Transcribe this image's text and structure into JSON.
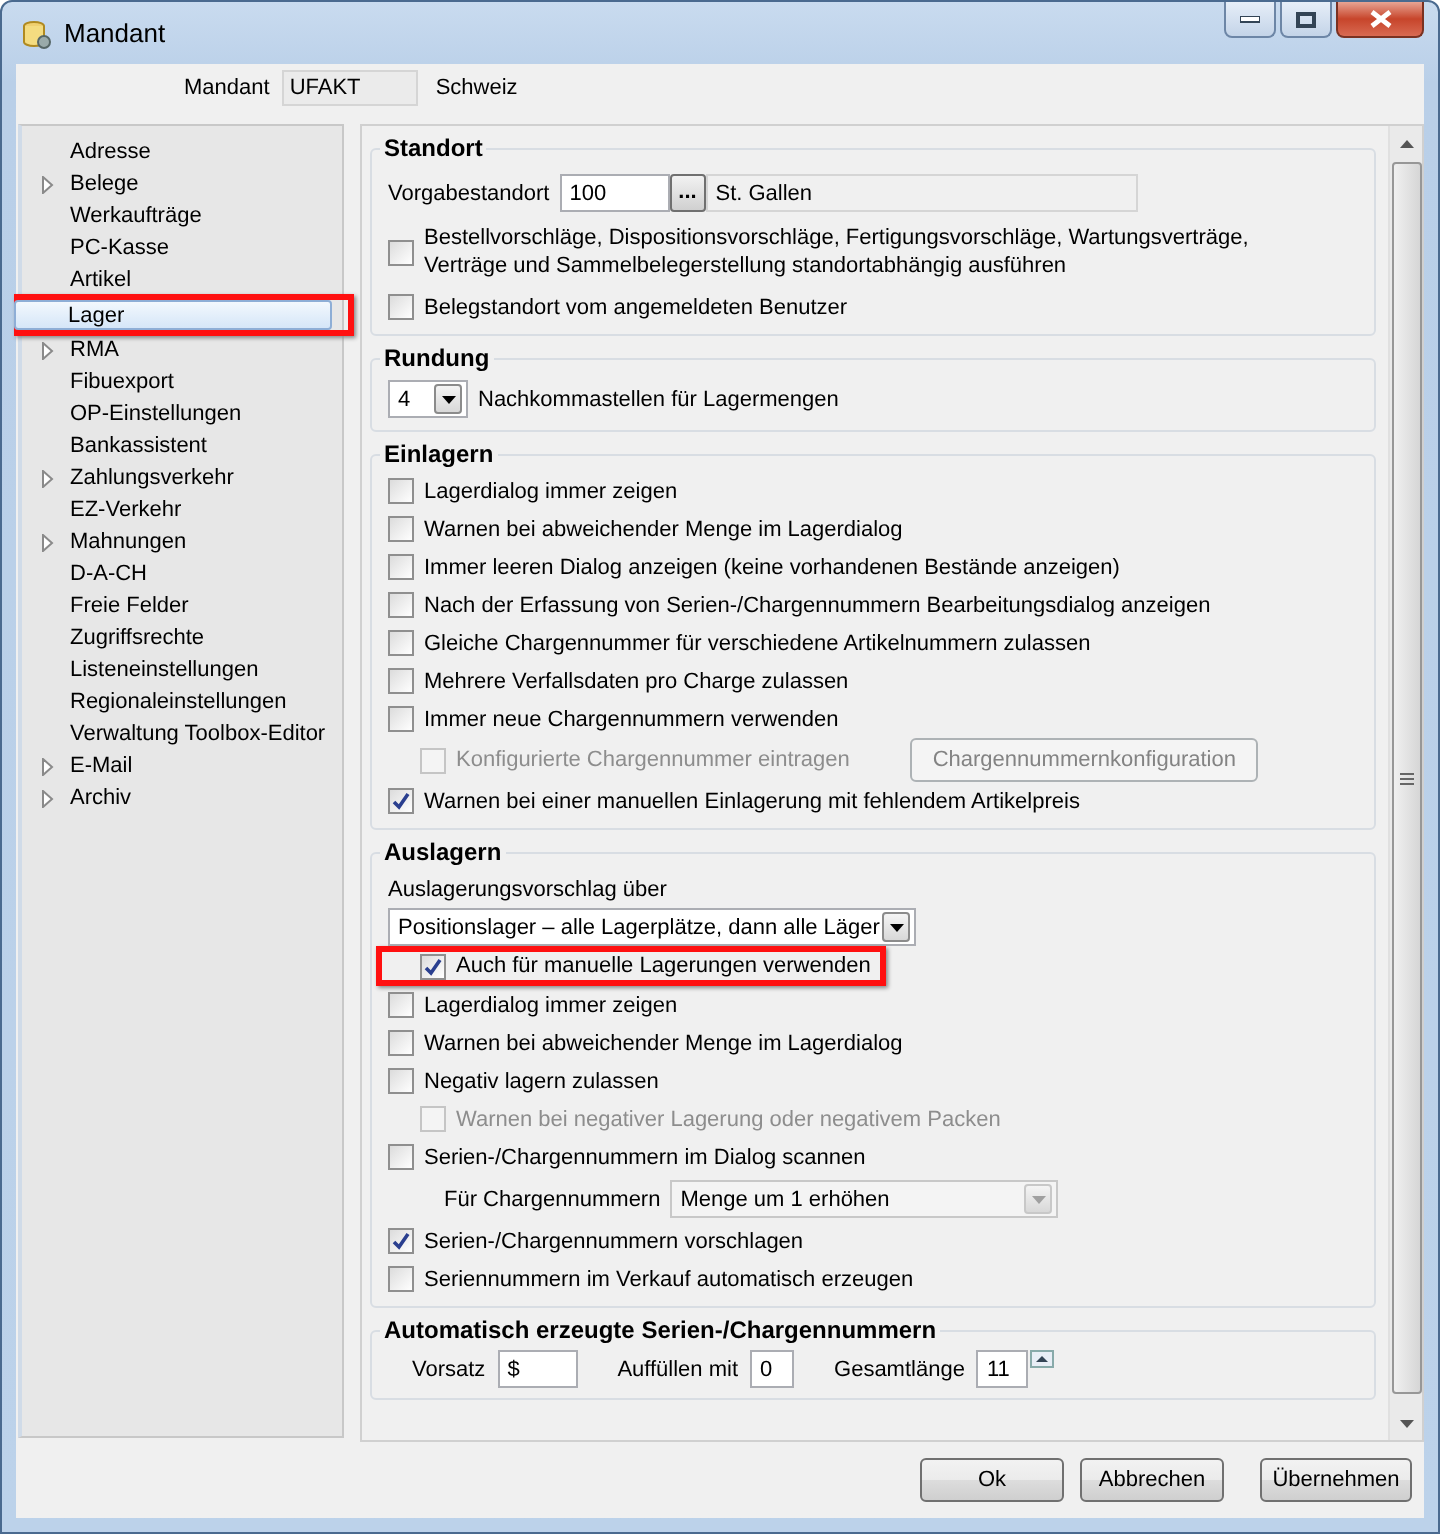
{
  "window": {
    "title": "Mandant"
  },
  "mandant": {
    "label": "Mandant",
    "code": "UFAKT",
    "name": "Schweiz"
  },
  "sidebar": {
    "items": [
      {
        "label": "Adresse",
        "expandable": false,
        "selected": false,
        "highlighted": false
      },
      {
        "label": "Belege",
        "expandable": true,
        "selected": false,
        "highlighted": false
      },
      {
        "label": "Werkaufträge",
        "expandable": false,
        "selected": false,
        "highlighted": false
      },
      {
        "label": "PC-Kasse",
        "expandable": false,
        "selected": false,
        "highlighted": false
      },
      {
        "label": "Artikel",
        "expandable": false,
        "selected": false,
        "highlighted": false
      },
      {
        "label": "Lager",
        "expandable": false,
        "selected": true,
        "highlighted": true
      },
      {
        "label": "RMA",
        "expandable": true,
        "selected": false,
        "highlighted": false
      },
      {
        "label": "Fibuexport",
        "expandable": false,
        "selected": false,
        "highlighted": false
      },
      {
        "label": "OP-Einstellungen",
        "expandable": false,
        "selected": false,
        "highlighted": false
      },
      {
        "label": "Bankassistent",
        "expandable": false,
        "selected": false,
        "highlighted": false
      },
      {
        "label": "Zahlungsverkehr",
        "expandable": true,
        "selected": false,
        "highlighted": false
      },
      {
        "label": "EZ-Verkehr",
        "expandable": false,
        "selected": false,
        "highlighted": false
      },
      {
        "label": "Mahnungen",
        "expandable": true,
        "selected": false,
        "highlighted": false
      },
      {
        "label": "D-A-CH",
        "expandable": false,
        "selected": false,
        "highlighted": false
      },
      {
        "label": "Freie Felder",
        "expandable": false,
        "selected": false,
        "highlighted": false
      },
      {
        "label": "Zugriffsrechte",
        "expandable": false,
        "selected": false,
        "highlighted": false
      },
      {
        "label": "Listeneinstellungen",
        "expandable": false,
        "selected": false,
        "highlighted": false
      },
      {
        "label": "Regionaleinstellungen",
        "expandable": false,
        "selected": false,
        "highlighted": false
      },
      {
        "label": "Verwaltung Toolbox-Editor",
        "expandable": false,
        "selected": false,
        "highlighted": false
      },
      {
        "label": "E-Mail",
        "expandable": true,
        "selected": false,
        "highlighted": false
      },
      {
        "label": "Archiv",
        "expandable": true,
        "selected": false,
        "highlighted": false
      }
    ]
  },
  "sections": [
    {
      "title": "Standort",
      "rows": [
        {
          "kind": "lookup",
          "label": "Vorgabestandort",
          "value": "100",
          "button": "...",
          "description": "St. Gallen"
        },
        {
          "kind": "checkbox",
          "label": "Bestellvorschläge, Dispositionsvorschläge, Fertigungsvorschläge, Wartungsverträge,\nVerträge und Sammelbelegerstellung standortabhängig ausführen",
          "checked": false,
          "disabled": false,
          "highlighted": false
        },
        {
          "kind": "checkbox",
          "label": "Belegstandort vom angemeldeten Benutzer",
          "checked": false,
          "disabled": false,
          "highlighted": false
        }
      ]
    },
    {
      "title": "Rundung",
      "rows": [
        {
          "kind": "combo",
          "value": "4",
          "label": "Nachkommastellen für Lagermengen"
        }
      ]
    },
    {
      "title": "Einlagern",
      "rows": [
        {
          "kind": "checkbox",
          "label": "Lagerdialog immer zeigen",
          "checked": false,
          "disabled": false,
          "highlighted": false
        },
        {
          "kind": "checkbox",
          "label": "Warnen bei abweichender Menge im Lagerdialog",
          "checked": false,
          "disabled": false,
          "highlighted": false
        },
        {
          "kind": "checkbox",
          "label": "Immer leeren Dialog anzeigen (keine vorhandenen Bestände anzeigen)",
          "checked": false,
          "disabled": false,
          "highlighted": false
        },
        {
          "kind": "checkbox",
          "label": "Nach der Erfassung von Serien-/Chargennummern Bearbeitungsdialog anzeigen",
          "checked": false,
          "disabled": false,
          "highlighted": false
        },
        {
          "kind": "checkbox",
          "label": "Gleiche Chargennummer für verschiedene Artikelnummern zulassen",
          "checked": false,
          "disabled": false,
          "highlighted": false
        },
        {
          "kind": "checkbox",
          "label": "Mehrere Verfallsdaten pro Charge zulassen",
          "checked": false,
          "disabled": false,
          "highlighted": false
        },
        {
          "kind": "checkbox",
          "label": "Immer neue Chargennummern verwenden",
          "checked": false,
          "disabled": false,
          "highlighted": false
        },
        {
          "kind": "subcheckbox",
          "label": "Konfigurierte Chargennummer eintragen",
          "checked": false,
          "disabled": true,
          "highlighted": false,
          "button": {
            "label": "Chargennummernkonfiguration",
            "disabled": true
          }
        },
        {
          "kind": "checkbox",
          "label": "Warnen bei einer manuellen Einlagerung mit fehlendem Artikelpreis",
          "checked": true,
          "disabled": false,
          "highlighted": false
        }
      ]
    },
    {
      "title": "Auslagern",
      "rows": [
        {
          "kind": "caption",
          "label": "Auslagerungsvorschlag über"
        },
        {
          "kind": "select",
          "value": "Positionslager – alle Lagerplätze, dann alle Läger",
          "disabled": false
        },
        {
          "kind": "subcheckbox",
          "label": "Auch für manuelle Lagerungen verwenden",
          "checked": true,
          "disabled": false,
          "highlighted": true
        },
        {
          "kind": "checkbox",
          "label": "Lagerdialog immer zeigen",
          "checked": false,
          "disabled": false,
          "highlighted": false
        },
        {
          "kind": "checkbox",
          "label": "Warnen bei abweichender Menge im Lagerdialog",
          "checked": false,
          "disabled": false,
          "highlighted": false
        },
        {
          "kind": "checkbox",
          "label": "Negativ lagern zulassen",
          "checked": false,
          "disabled": false,
          "highlighted": false
        },
        {
          "kind": "subcheckbox",
          "label": "Warnen bei negativer Lagerung oder negativem Packen",
          "checked": false,
          "disabled": true,
          "highlighted": false
        },
        {
          "kind": "checkbox",
          "label": "Serien-/Chargennummern im Dialog scannen",
          "checked": false,
          "disabled": false,
          "highlighted": false
        },
        {
          "kind": "labeled-select",
          "label": "Für Chargennummern",
          "value": "Menge um 1 erhöhen",
          "disabled": true
        },
        {
          "kind": "checkbox",
          "label": "Serien-/Chargennummern vorschlagen",
          "checked": true,
          "disabled": false,
          "highlighted": false
        },
        {
          "kind": "checkbox",
          "label": "Seriennummern im Verkauf automatisch erzeugen",
          "checked": false,
          "disabled": false,
          "highlighted": false
        }
      ]
    },
    {
      "title": "Automatisch erzeugte Serien-/Chargennummern",
      "rows": [
        {
          "kind": "fields",
          "fields": [
            {
              "label": "Vorsatz",
              "value": "$",
              "spinner": false
            },
            {
              "label": "Auffüllen mit",
              "value": "0",
              "spinner": false
            },
            {
              "label": "Gesamtlänge",
              "value": "11",
              "spinner": true
            }
          ]
        }
      ]
    }
  ],
  "buttons": [
    {
      "label": "Ok"
    },
    {
      "label": "Abbrechen"
    },
    {
      "label": "Übernehmen"
    }
  ]
}
